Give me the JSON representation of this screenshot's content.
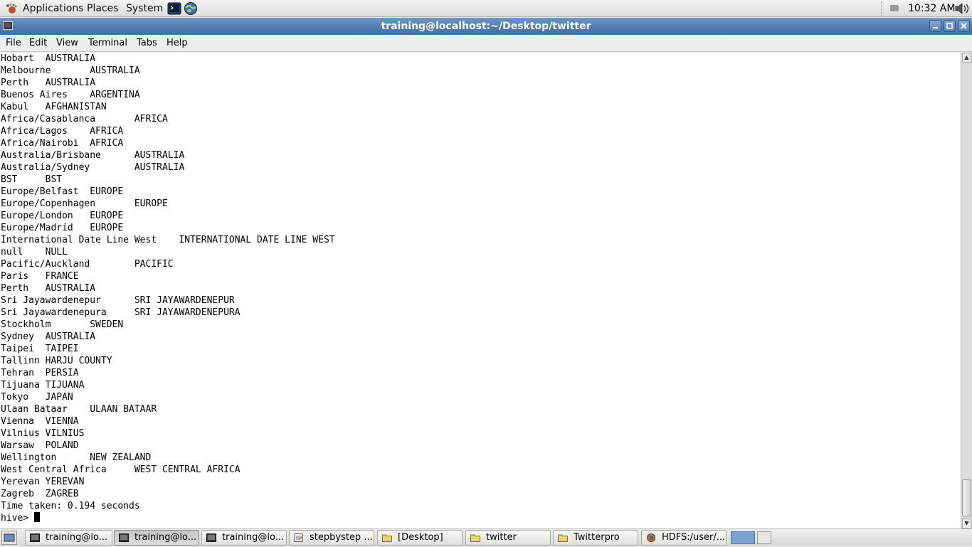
{
  "top_panel": {
    "menus": [
      "Applications",
      "Places",
      "System"
    ],
    "clock": "10:32 AM"
  },
  "window": {
    "title": "training@localhost:~/Desktop/twitter",
    "menubar": {
      "file": "File",
      "edit": "Edit",
      "view": "View",
      "terminal": "Terminal",
      "tabs": "Tabs",
      "help": "Help"
    }
  },
  "terminal": {
    "lines": [
      "Hobart  AUSTRALIA",
      "Melbourne       AUSTRALIA",
      "Perth   AUSTRALIA",
      "Buenos Aires    ARGENTINA",
      "Kabul   AFGHANISTAN",
      "Africa/Casablanca       AFRICA",
      "Africa/Lagos    AFRICA",
      "Africa/Nairobi  AFRICA",
      "Australia/Brisbane      AUSTRALIA",
      "Australia/Sydney        AUSTRALIA",
      "BST     BST",
      "Europe/Belfast  EUROPE",
      "Europe/Copenhagen       EUROPE",
      "Europe/London   EUROPE",
      "Europe/Madrid   EUROPE",
      "International Date Line West    INTERNATIONAL DATE LINE WEST",
      "null    NULL",
      "Pacific/Auckland        PACIFIC",
      "Paris   FRANCE",
      "Perth   AUSTRALIA",
      "Sri Jayawardenepur      SRI JAYAWARDENEPUR",
      "Sri Jayawardenepura     SRI JAYAWARDENEPURA",
      "Stockholm       SWEDEN",
      "Sydney  AUSTRALIA",
      "Taipei  TAIPEI",
      "Tallinn HARJU COUNTY",
      "Tehran  PERSIA",
      "Tijuana TIJUANA",
      "Tokyo   JAPAN",
      "Ulaan Bataar    ULAAN BATAAR",
      "Vienna  VIENNA",
      "Vilnius VILNIUS",
      "Warsaw  POLAND",
      "Wellington      NEW ZEALAND",
      "West Central Africa     WEST CENTRAL AFRICA",
      "Yerevan YEREVAN",
      "Zagreb  ZAGREB",
      "Time taken: 0.194 seconds"
    ],
    "prompt": "hive> "
  },
  "taskbar": {
    "tasks": [
      {
        "label": "training@lo...",
        "icon": "terminal-icon",
        "active": false
      },
      {
        "label": "training@lo...",
        "icon": "terminal-icon",
        "active": true
      },
      {
        "label": "training@lo...",
        "icon": "terminal-icon",
        "active": false
      },
      {
        "label": "stepbystep ...",
        "icon": "text-editor-icon",
        "active": false
      },
      {
        "label": "[Desktop]",
        "icon": "folder-icon",
        "active": false
      },
      {
        "label": "twitter",
        "icon": "folder-icon",
        "active": false
      },
      {
        "label": "Twitterpro",
        "icon": "folder-icon",
        "active": false
      },
      {
        "label": "HDFS:/user/...",
        "icon": "firefox-icon",
        "active": false
      }
    ]
  },
  "colors": {
    "titlebar": "#5580b4",
    "terminal_bg": "#ffffff",
    "terminal_fg": "#000000"
  }
}
